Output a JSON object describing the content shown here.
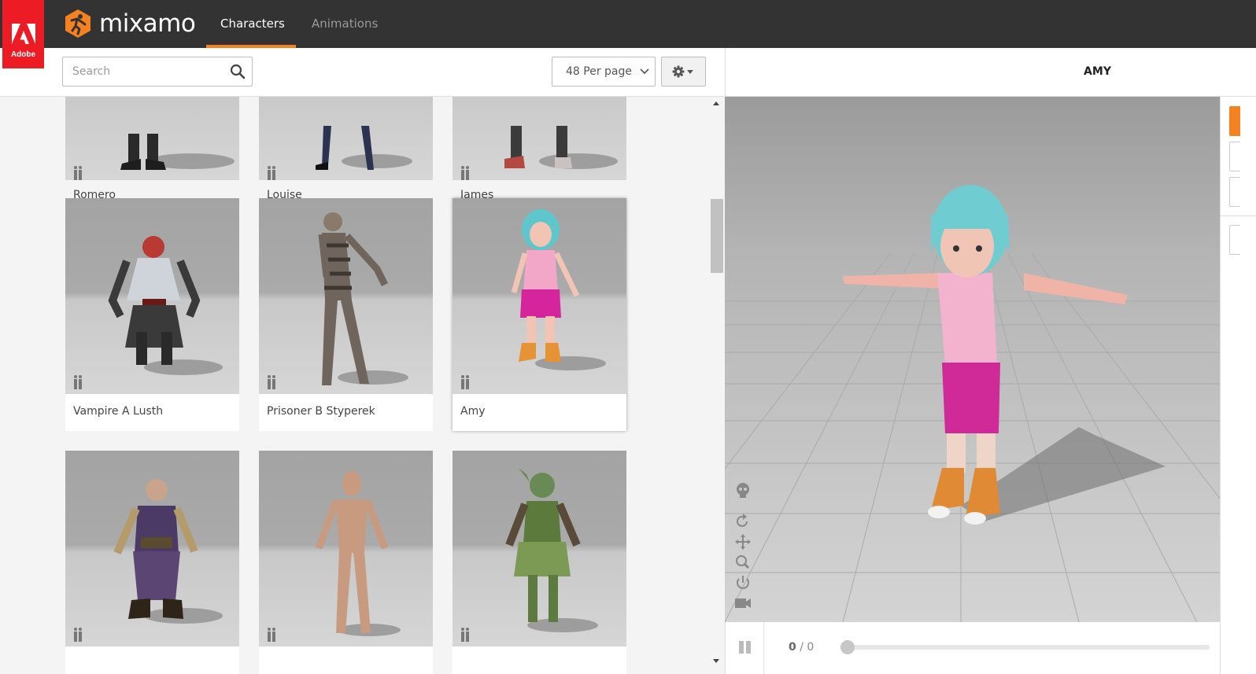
{
  "brand": {
    "adobe_label": "Adobe",
    "app_name": "mixamo",
    "accent": "#f58220",
    "adobe_red": "#ed1c24"
  },
  "nav": {
    "tabs": [
      {
        "label": "Characters",
        "active": true
      },
      {
        "label": "Animations",
        "active": false
      }
    ]
  },
  "toolbar": {
    "search_placeholder": "Search",
    "search_value": "",
    "per_page": "48 Per page",
    "settings_icon": "gear-icon"
  },
  "grid": {
    "cards": [
      {
        "name": "Romero",
        "selected": false
      },
      {
        "name": "Louise",
        "selected": false
      },
      {
        "name": "James",
        "selected": false
      },
      {
        "name": "Vampire A Lusth",
        "selected": false
      },
      {
        "name": "Prisoner B Styperek",
        "selected": false
      },
      {
        "name": "Amy",
        "selected": true
      },
      {
        "name": "",
        "selected": false
      },
      {
        "name": "",
        "selected": false
      },
      {
        "name": "",
        "selected": false
      }
    ]
  },
  "preview": {
    "character_name": "AMY",
    "frame_current": "0",
    "frame_separator": "/",
    "frame_total": "0",
    "tools": [
      "skeleton-icon",
      "reset-view-icon",
      "pan-icon",
      "zoom-icon",
      "power-icon",
      "camera-icon"
    ]
  }
}
